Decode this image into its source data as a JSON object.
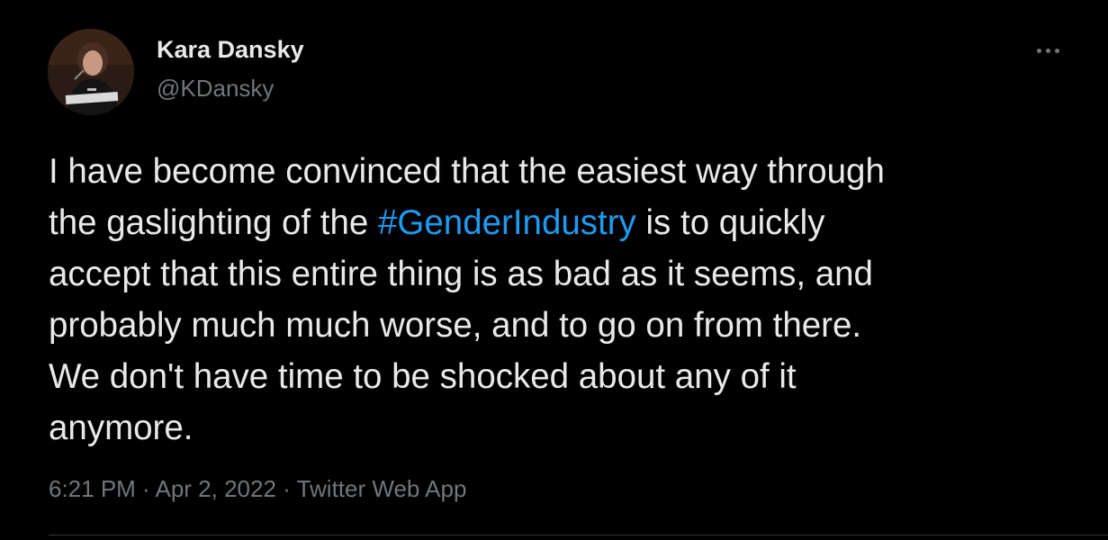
{
  "author": {
    "display_name": "Kara Dansky",
    "handle": "@KDansky",
    "avatar_icon": "profile-photo"
  },
  "menu": {
    "more_icon": "more-horizontal-icon"
  },
  "tweet": {
    "line1": "I have become convinced that the easiest way through",
    "line2_before": "the gaslighting of the ",
    "hashtag": "#GenderIndustry",
    "line2_after": " is to quickly",
    "line3": "accept that this entire thing is as bad as it seems, and",
    "line4": "probably much much worse, and to go on from there.",
    "line5": "We don't have time to be shocked about any of it",
    "line6": "anymore."
  },
  "meta": {
    "time": "6:21 PM",
    "separator": " · ",
    "date": "Apr 2, 2022",
    "source": "Twitter Web App"
  },
  "colors": {
    "background": "#000000",
    "text": "#e7e9ea",
    "secondary": "#71767b",
    "link": "#1d9bf0",
    "divider": "#2f3336"
  }
}
